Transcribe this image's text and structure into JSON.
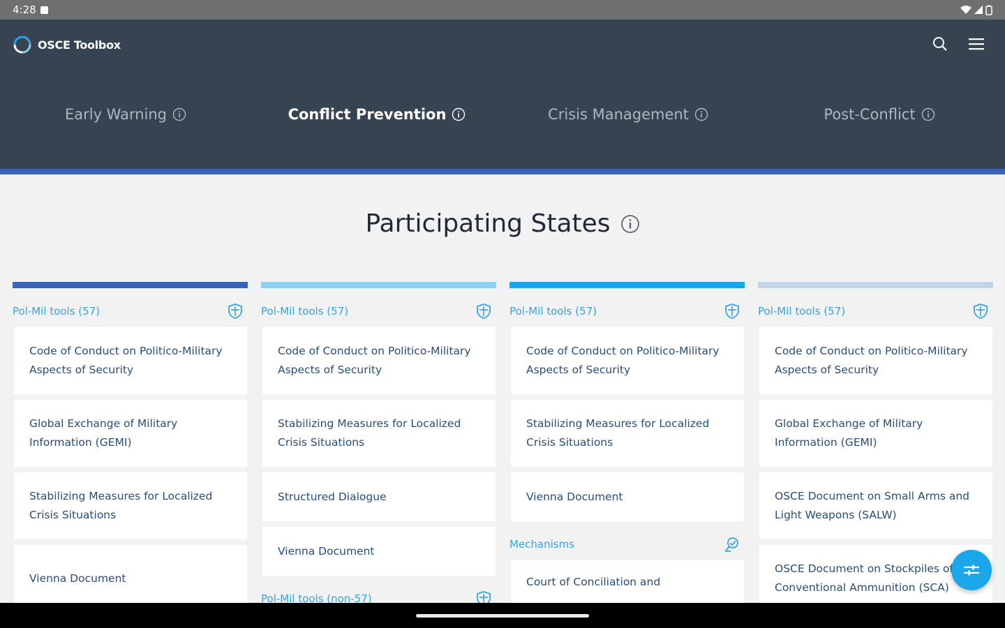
{
  "status_bar": {
    "time": "4:28"
  },
  "header": {
    "app_name": "OSCE Toolbox",
    "search_icon": "search-icon",
    "menu_icon": "menu-icon",
    "logo_icon": "osce-logo-icon"
  },
  "phases": [
    {
      "label": "Early Warning",
      "active": false
    },
    {
      "label": "Conflict Prevention",
      "active": true
    },
    {
      "label": "Crisis Management",
      "active": false
    },
    {
      "label": "Post-Conflict",
      "active": false
    }
  ],
  "section": {
    "title": "Participating States"
  },
  "colors": {
    "header_bg": "#364452",
    "accent_underline": "#3a64b6",
    "column_bars": [
      "#3a64b6",
      "#8fd0f0",
      "#1aa6e8",
      "#c5d3e6"
    ],
    "link": "#3aa2dc",
    "card_text": "#2a4d78",
    "fab": "#1aa6e8"
  },
  "columns": [
    {
      "group": "Pol-Mil tools (57)",
      "items": [
        "Code of Conduct on Politico-Military Aspects of Security",
        "Global Exchange of Military Information (GEMI)",
        "Stabilizing Measures for Localized Crisis Situations",
        "Vienna Document"
      ]
    },
    {
      "group": "Pol-Mil tools (57)",
      "items": [
        "Code of Conduct on Politico-Military Aspects of Security",
        "Stabilizing Measures for Localized Crisis Situations",
        "Structured Dialogue",
        "Vienna Document"
      ],
      "group2": "Pol-Mil tools (non-57)"
    },
    {
      "group": "Pol-Mil tools (57)",
      "items": [
        "Code of Conduct on Politico-Military Aspects of Security",
        "Stabilizing Measures for Localized Crisis Situations",
        "Vienna Document"
      ],
      "group2": "Mechanisms",
      "items2": [
        "Court of Conciliation and"
      ]
    },
    {
      "group": "Pol-Mil tools (57)",
      "items": [
        "Code of Conduct on Politico-Military Aspects of Security",
        "Global Exchange of Military Information (GEMI)",
        "OSCE Document on Small Arms and Light Weapons (SALW)",
        "OSCE Document on Stockpiles of Conventional Ammunition (SCA)"
      ]
    }
  ],
  "fab": {
    "icon": "filter-sliders-icon"
  }
}
